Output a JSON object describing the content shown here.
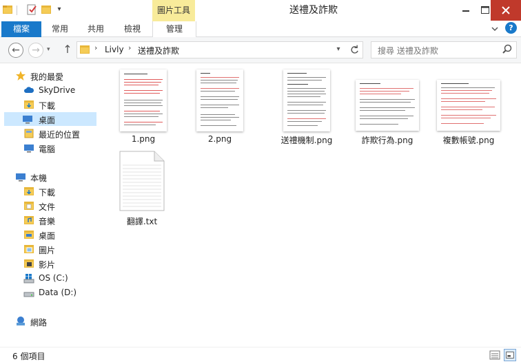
{
  "window": {
    "title": "送禮及詐欺",
    "context_tab_header": "圖片工具"
  },
  "ribbon": {
    "tabs": [
      "檔案",
      "常用",
      "共用",
      "檢視",
      "管理"
    ]
  },
  "address": {
    "crumbs": [
      "Livly",
      "送禮及詐欺"
    ],
    "search_placeholder": "搜尋 送禮及詐欺"
  },
  "nav": {
    "favorites_header": "我的最愛",
    "favorites": [
      "SkyDrive",
      "下載",
      "桌面",
      "最近的位置",
      "電腦"
    ],
    "thispc_header": "本機",
    "thispc": [
      "下載",
      "文件",
      "音樂",
      "桌面",
      "圖片",
      "影片",
      "OS (C:)",
      "Data (D:)"
    ],
    "network": "網路"
  },
  "files": [
    {
      "name": "1.png",
      "type": "image"
    },
    {
      "name": "2.png",
      "type": "image"
    },
    {
      "name": "送禮機制.png",
      "type": "image"
    },
    {
      "name": "詐欺行為.png",
      "type": "image"
    },
    {
      "name": "複數帳號.png",
      "type": "image"
    },
    {
      "name": "翻譯.txt",
      "type": "text"
    }
  ],
  "status": {
    "count": "6 個項目"
  },
  "colors": {
    "accent": "#1979ca",
    "context_tab": "#f8eb9a",
    "selection": "#cce8ff",
    "close": "#c0392b"
  }
}
